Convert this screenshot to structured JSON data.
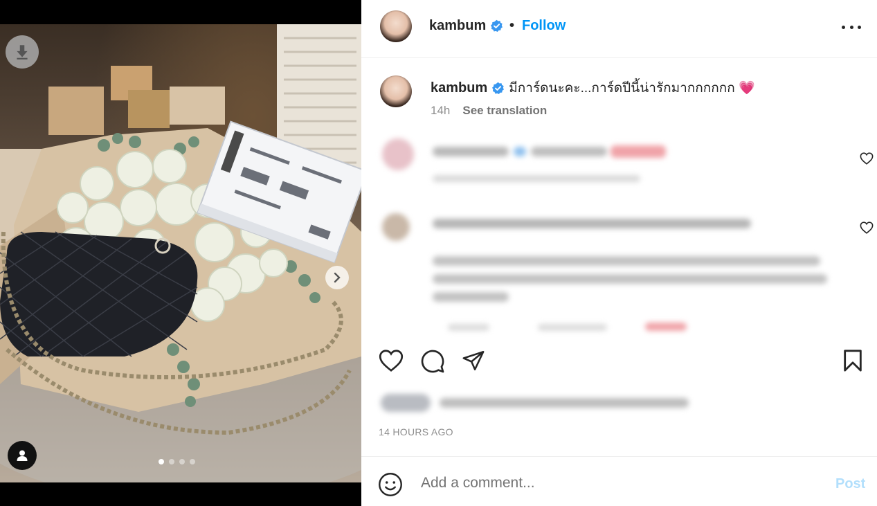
{
  "post": {
    "username": "kambum",
    "follow_label": "Follow",
    "separator": "•",
    "caption_text": "มีการ์ดนะคะ...การ์ดปีนี้น่ารักมากกกกกก 💗",
    "time_ago": "14h",
    "see_translation": "See translation",
    "timestamp": "14 HOURS AGO",
    "comment_placeholder": "Add a comment...",
    "post_label": "Post"
  },
  "carousel": {
    "current_slide": 1,
    "total_slides": 4
  },
  "icons": {
    "download": "download-icon",
    "next": "chevron-right-icon",
    "tag": "user-tag-icon",
    "verified": "verified-badge-icon",
    "more": "more-options-icon",
    "like": "heart-icon",
    "comment": "comment-icon",
    "share": "share-icon",
    "save": "bookmark-icon",
    "emoji": "emoji-icon"
  },
  "colors": {
    "accent": "#0095f6",
    "verified": "#3897f0",
    "post_disabled": "#b2dffc",
    "muted": "#8e8e8e"
  }
}
